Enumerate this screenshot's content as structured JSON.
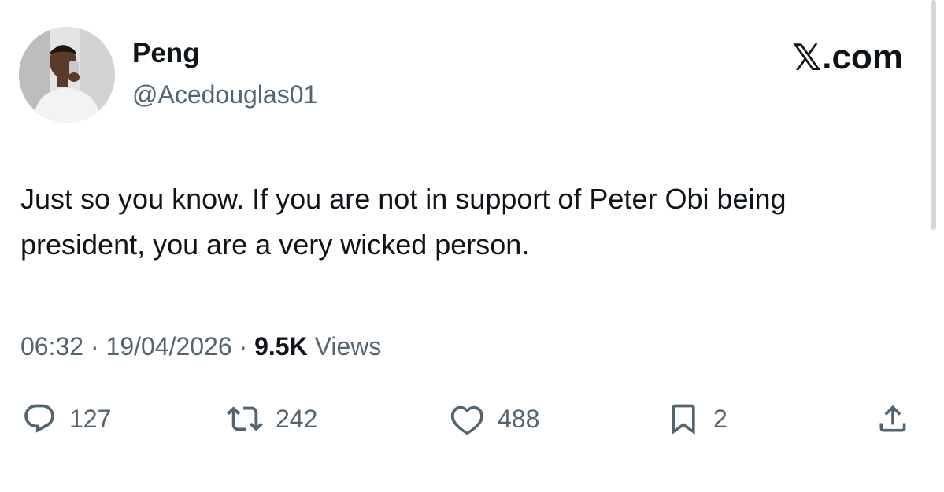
{
  "user": {
    "display_name": "Peng",
    "handle": "@Acedouglas01"
  },
  "brand": {
    "x_symbol": "𝕏",
    "domain": ".com"
  },
  "tweet": {
    "text": "Just so you know. If you are not in support of Peter Obi being president, you are a very wicked person.",
    "time": "06:32",
    "date": "19/04/2026",
    "views_count": "9.5K",
    "views_label": "Views"
  },
  "actions": {
    "replies": "127",
    "reposts": "242",
    "likes": "488",
    "bookmarks": "2"
  },
  "icons": {
    "reply": "speech-bubble-icon",
    "repost": "repost-arrows-icon",
    "like": "heart-icon",
    "bookmark": "bookmark-icon",
    "share": "share-upload-icon"
  },
  "colors": {
    "text_primary": "#0f1419",
    "text_secondary": "#536471",
    "background": "#ffffff"
  }
}
